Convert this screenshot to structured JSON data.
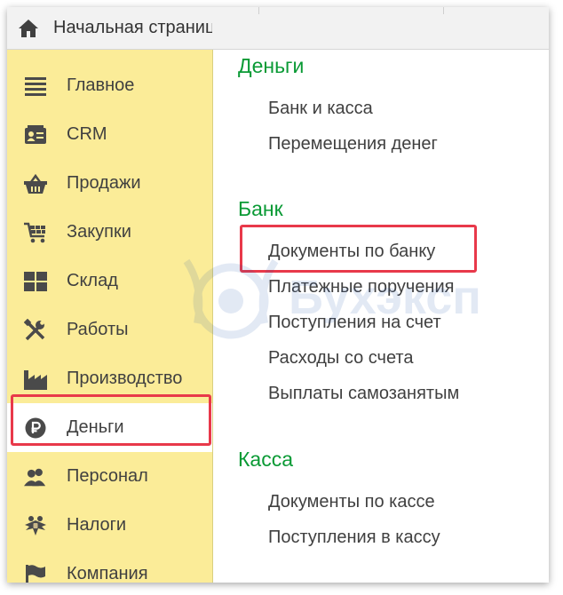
{
  "header": {
    "home_tab_label": "Начальная страница",
    "home_icon": "home-icon"
  },
  "sidebar": {
    "items": [
      {
        "label": "Главное",
        "icon": "menu-lines-icon"
      },
      {
        "label": "CRM",
        "icon": "contact-card-icon"
      },
      {
        "label": "Продажи",
        "icon": "shopping-basket-icon"
      },
      {
        "label": "Закупки",
        "icon": "shopping-cart-icon"
      },
      {
        "label": "Склад",
        "icon": "warehouse-boxes-icon"
      },
      {
        "label": "Работы",
        "icon": "tools-icon"
      },
      {
        "label": "Производство",
        "icon": "factory-icon"
      },
      {
        "label": "Деньги",
        "icon": "ruble-coin-icon",
        "active": true
      },
      {
        "label": "Персонал",
        "icon": "people-icon"
      },
      {
        "label": "Налоги",
        "icon": "emblem-icon"
      },
      {
        "label": "Компания",
        "icon": "flag-icon"
      }
    ]
  },
  "panel": {
    "sections": [
      {
        "title": "Деньги",
        "links": [
          "Банк и касса",
          "Перемещения денег"
        ]
      },
      {
        "title": "Банк",
        "links": [
          "Документы по банку",
          "Платежные поручения",
          "Поступления на счет",
          "Расходы со счета",
          "Выплаты самозанятым"
        ]
      },
      {
        "title": "Касса",
        "links": [
          "Документы по кассе",
          "Поступления в кассу"
        ]
      }
    ],
    "highlighted_link": "Документы по банку"
  },
  "watermark": {
    "text": "Бухэксп"
  },
  "colors": {
    "sidebar_bg": "#fbec98",
    "section_title": "#0a9a35",
    "highlight_border": "#e8394a",
    "text": "#404040"
  }
}
